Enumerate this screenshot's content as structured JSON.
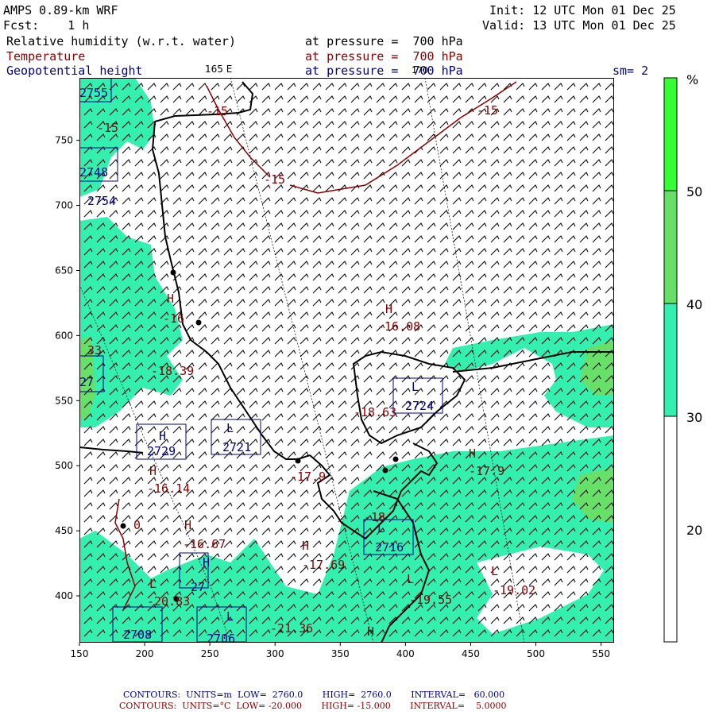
{
  "header": {
    "model": "AMPS 0.89-km WRF",
    "fcst_label": "Fcst:",
    "fcst_value": "1 h",
    "init_label": "Init:",
    "init_value": "12 UTC Mon 01 Dec 25",
    "valid_label": "Valid:",
    "valid_value": "13 UTC Mon 01 Dec 25",
    "fields": [
      {
        "name": "Relative humidity (w.r.t. water)",
        "level": "at pressure =  700 hPa",
        "color": "#000000"
      },
      {
        "name": "Temperature",
        "level": "at pressure =  700 hPa",
        "color": "#8b0000"
      },
      {
        "name": "Geopotential height",
        "level": "at pressure =  700 hPa",
        "color": "#00008b"
      }
    ],
    "sm": "sm= 2",
    "lon_label_165": "165 E",
    "lon_label_170": "170"
  },
  "axes": {
    "x_ticks": [
      "150",
      "200",
      "250",
      "300",
      "350",
      "400",
      "450",
      "500",
      "550"
    ],
    "x_values": [
      150,
      200,
      250,
      300,
      350,
      400,
      450,
      500,
      550
    ],
    "y_ticks": [
      "400",
      "450",
      "500",
      "550",
      "600",
      "650",
      "700",
      "750"
    ],
    "y_values": [
      400,
      450,
      500,
      550,
      600,
      650,
      700,
      750
    ],
    "x_range": [
      150,
      560
    ],
    "y_range": [
      364,
      798
    ]
  },
  "colorbar": {
    "unit": "%",
    "levels": [
      "20",
      "30",
      "40",
      "50"
    ],
    "colors": [
      "#ffffff",
      "#33f0b0",
      "#66e066",
      "#33ff33"
    ]
  },
  "map_labels": {
    "temperature": [
      "-15",
      "-15",
      "-15",
      "-15",
      "-16",
      "-16.08",
      "-18.39",
      "-18.63",
      "-17.9",
      "-17.9",
      "-16.14",
      "-16.67",
      "-17.69",
      "-18",
      "-19.55",
      "-19.02",
      "-20.83",
      "-21.36"
    ],
    "highs": [
      "H",
      "H",
      "H",
      "H",
      "H",
      "H",
      "H",
      "H",
      "H"
    ],
    "lows": [
      "L",
      "L",
      "L",
      "L",
      "L",
      "L",
      "L"
    ],
    "heights": [
      "2755",
      "2748",
      "2729",
      "2721",
      "2724",
      "2716",
      "2708",
      "2706",
      "27",
      "2754",
      "27"
    ],
    "misc": [
      "33",
      "0"
    ]
  },
  "footer": {
    "line1": "CONTOURS:  UNITS=m  LOW=  2760.0       HIGH=  2760.0       INTERVAL=   60.000",
    "line2": "CONTOURS:  UNITS=°C  LOW= -20.000       HIGH= -15.000       INTERVAL=    5.0000",
    "color1": "#00008b",
    "color2": "#8b0000"
  }
}
